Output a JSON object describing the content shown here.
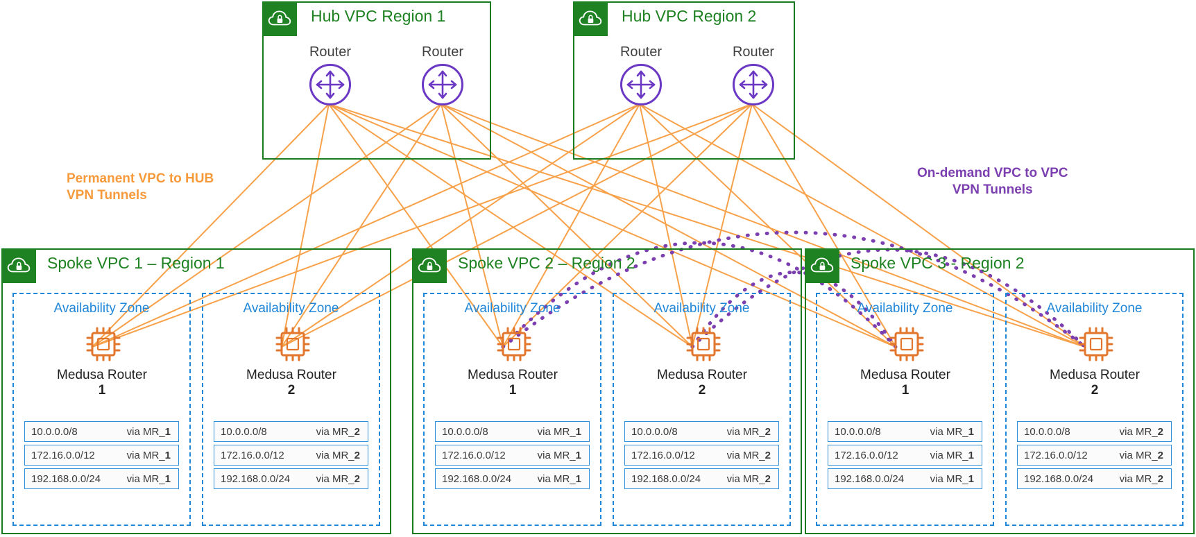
{
  "diagram": {
    "title": "Hub and Spoke VPC VPN Tunnel Architecture",
    "colors": {
      "vpc_green": "#1f8222",
      "router_purple": "#6b38c4",
      "tunnel_orange": "#f79a3c",
      "tunnel_purple": "#7b3fb0",
      "az_blue": "#1f86d8",
      "chip_orange": "#e2762c"
    }
  },
  "annotations": [
    {
      "id": "permanent-tunnels",
      "text": "Permanent VPC to HUB\nVPN Tunnels",
      "color": "#f79a3c"
    },
    {
      "id": "on-demand-tunnels",
      "text": "On-demand VPC to VPC\nVPN Tunnels",
      "color": "#7b3fb0"
    }
  ],
  "hubs": [
    {
      "id": "hub-1",
      "title": "Hub VPC Region 1",
      "icon": "cloud-lock-icon",
      "routers": [
        {
          "id": "hub1-router-1",
          "label": "Router",
          "icon": "router-icon"
        },
        {
          "id": "hub1-router-2",
          "label": "Router",
          "icon": "router-icon"
        }
      ]
    },
    {
      "id": "hub-2",
      "title": "Hub VPC Region 2",
      "icon": "cloud-lock-icon",
      "routers": [
        {
          "id": "hub2-router-1",
          "label": "Router",
          "icon": "router-icon"
        },
        {
          "id": "hub2-router-2",
          "label": "Router",
          "icon": "router-icon"
        }
      ]
    }
  ],
  "spokes": [
    {
      "id": "spoke-1",
      "title": "Spoke VPC 1 – Region 1",
      "icon": "cloud-lock-icon",
      "zones": [
        {
          "id": "spoke1-az1",
          "title": "Availability Zone",
          "chip_icon": "chip-icon",
          "router_name": "Medusa Router",
          "router_number": "1",
          "routes": [
            {
              "cidr": "10.0.0.0/8",
              "via_prefix": "via MR_",
              "via_suffix": "1"
            },
            {
              "cidr": "172.16.0.0/12",
              "via_prefix": "via MR_",
              "via_suffix": "1"
            },
            {
              "cidr": "192.168.0.0/24",
              "via_prefix": "via MR_",
              "via_suffix": "1"
            }
          ]
        },
        {
          "id": "spoke1-az2",
          "title": "Availability Zone",
          "chip_icon": "chip-icon",
          "router_name": "Medusa Router",
          "router_number": "2",
          "routes": [
            {
              "cidr": "10.0.0.0/8",
              "via_prefix": "via MR_",
              "via_suffix": "2"
            },
            {
              "cidr": "172.16.0.0/12",
              "via_prefix": "via MR_",
              "via_suffix": "2"
            },
            {
              "cidr": "192.168.0.0/24",
              "via_prefix": "via MR_",
              "via_suffix": "2"
            }
          ]
        }
      ]
    },
    {
      "id": "spoke-2",
      "title": "Spoke VPC 2 – Region 2",
      "icon": "cloud-lock-icon",
      "zones": [
        {
          "id": "spoke2-az1",
          "title": "Availability Zone",
          "chip_icon": "chip-icon",
          "router_name": "Medusa Router",
          "router_number": "1",
          "routes": [
            {
              "cidr": "10.0.0.0/8",
              "via_prefix": "via MR_",
              "via_suffix": "1"
            },
            {
              "cidr": "172.16.0.0/12",
              "via_prefix": "via MR_",
              "via_suffix": "1"
            },
            {
              "cidr": "192.168.0.0/24",
              "via_prefix": "via MR_",
              "via_suffix": "1"
            }
          ]
        },
        {
          "id": "spoke2-az2",
          "title": "Availability Zone",
          "chip_icon": "chip-icon",
          "router_name": "Medusa Router",
          "router_number": "2",
          "routes": [
            {
              "cidr": "10.0.0.0/8",
              "via_prefix": "via MR_",
              "via_suffix": "2"
            },
            {
              "cidr": "172.16.0.0/12",
              "via_prefix": "via MR_",
              "via_suffix": "2"
            },
            {
              "cidr": "192.168.0.0/24",
              "via_prefix": "via MR_",
              "via_suffix": "2"
            }
          ]
        }
      ]
    },
    {
      "id": "spoke-3",
      "title": "Spoke VPC 3 -  Region 2",
      "icon": "cloud-lock-icon",
      "zones": [
        {
          "id": "spoke3-az1",
          "title": "Availability Zone",
          "chip_icon": "chip-icon",
          "router_name": "Medusa Router",
          "router_number": "1",
          "routes": [
            {
              "cidr": "10.0.0.0/8",
              "via_prefix": "via MR_",
              "via_suffix": "1"
            },
            {
              "cidr": "172.16.0.0/12",
              "via_prefix": "via MR_",
              "via_suffix": "1"
            },
            {
              "cidr": "192.168.0.0/24",
              "via_prefix": "via MR_",
              "via_suffix": "1"
            }
          ]
        },
        {
          "id": "spoke3-az2",
          "title": "Availability Zone",
          "chip_icon": "chip-icon",
          "router_name": "Medusa Router",
          "router_number": "2",
          "routes": [
            {
              "cidr": "10.0.0.0/8",
              "via_prefix": "via MR_",
              "via_suffix": "2"
            },
            {
              "cidr": "172.16.0.0/12",
              "via_prefix": "via MR_",
              "via_suffix": "2"
            },
            {
              "cidr": "192.168.0.0/24",
              "via_prefix": "via MR_",
              "via_suffix": "2"
            }
          ]
        }
      ]
    }
  ]
}
